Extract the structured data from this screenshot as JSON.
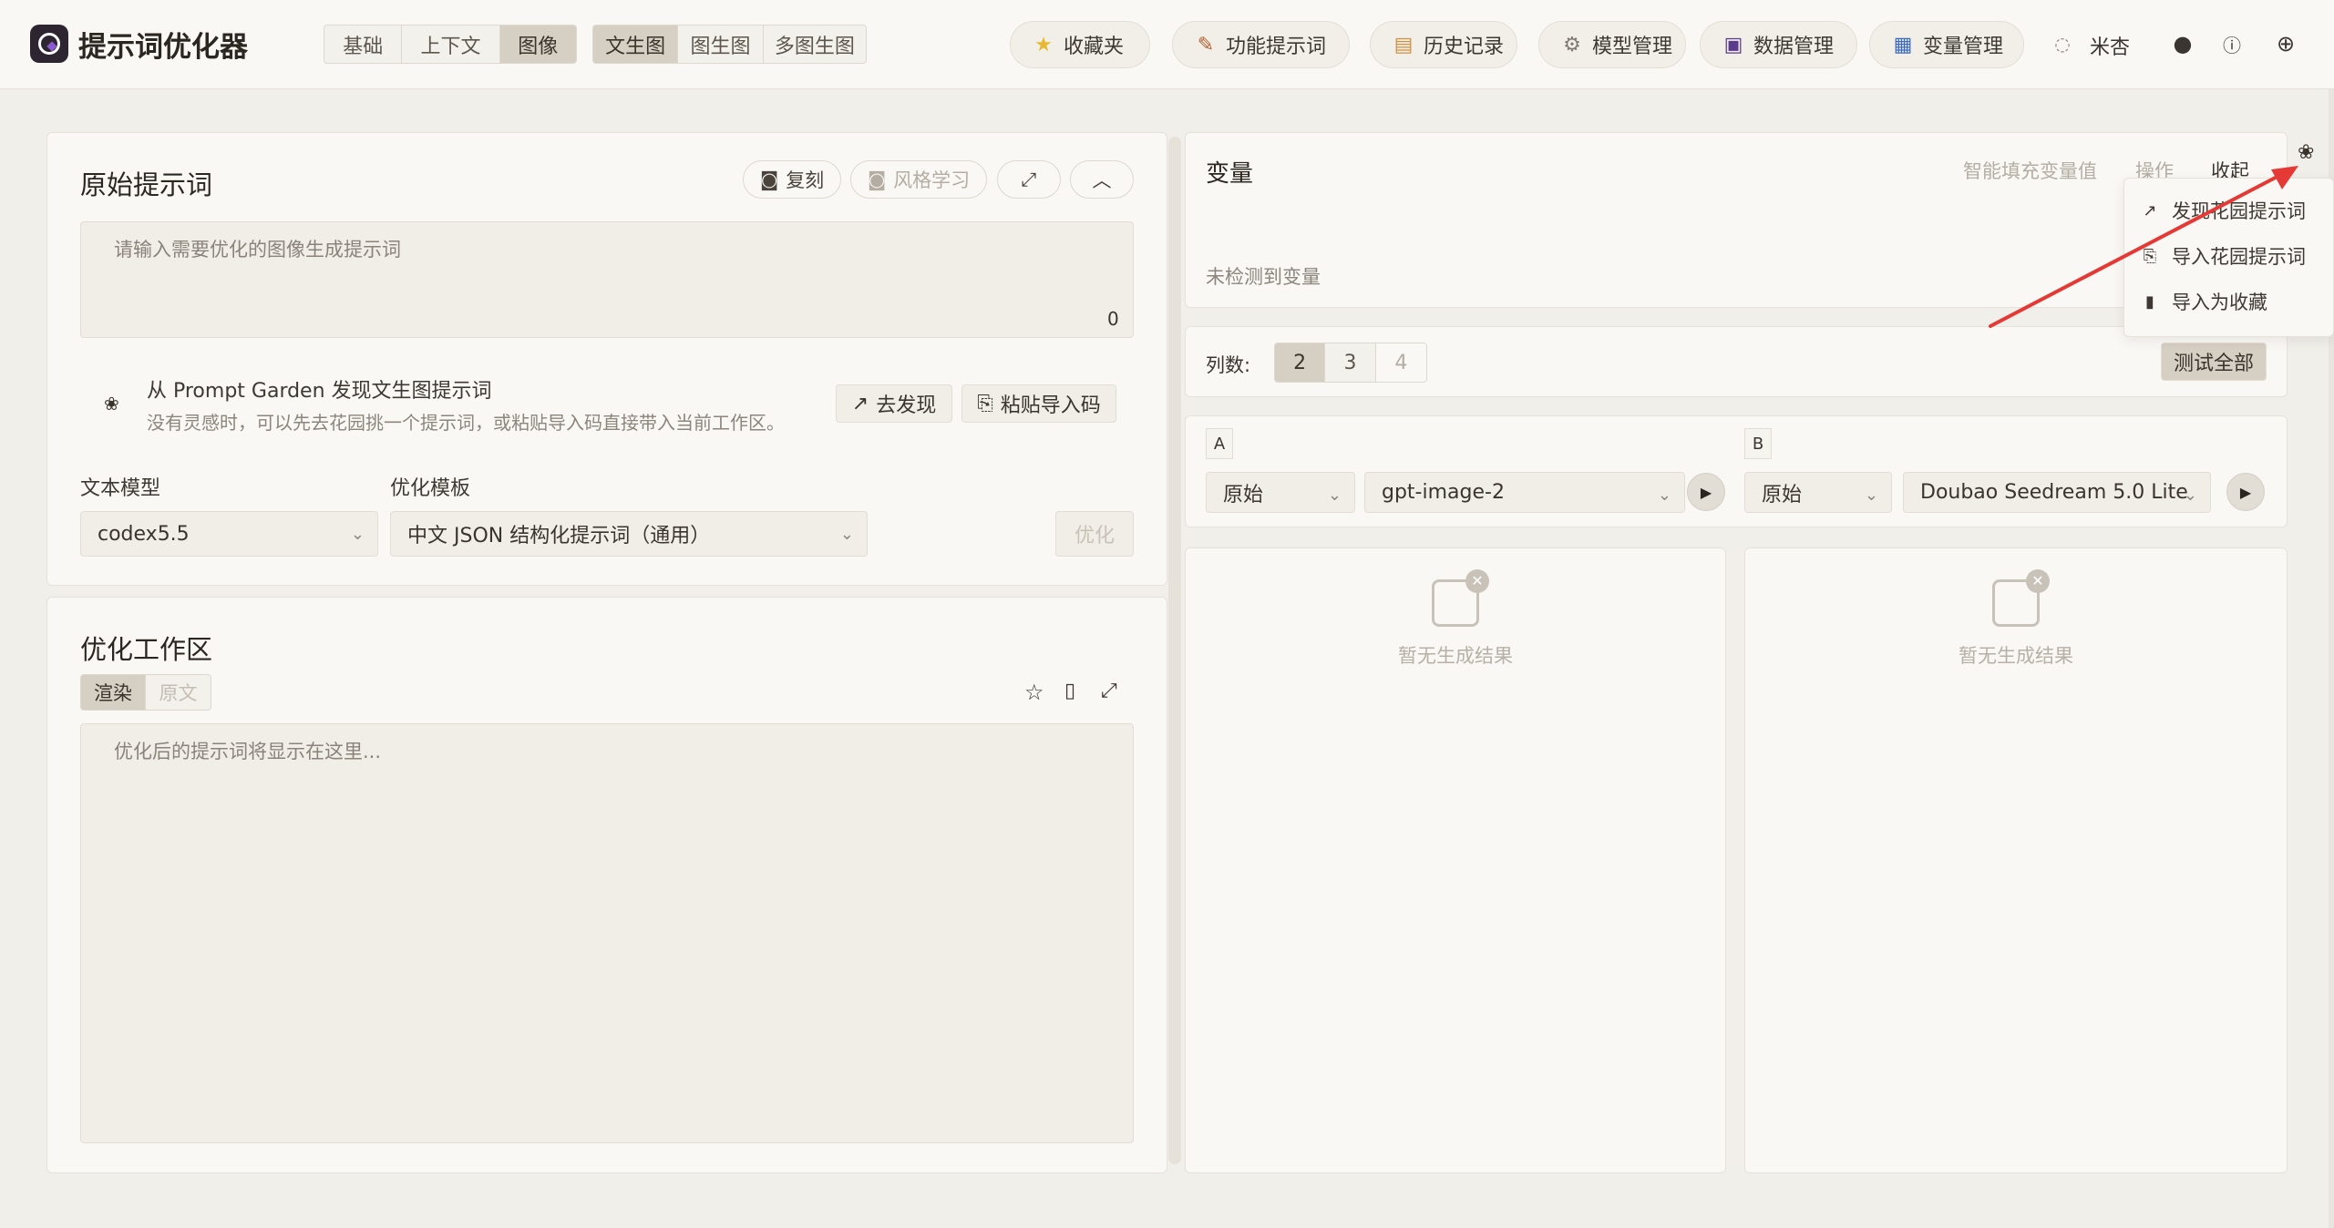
{
  "header": {
    "app_title": "提示词优化器",
    "mode_tabs": [
      "基础",
      "上下文",
      "图像"
    ],
    "active_mode": "图像",
    "image_tabs": [
      "文生图",
      "图生图",
      "多图生图"
    ],
    "active_image_tab": "文生图",
    "nav": {
      "favorites": "收藏夹",
      "function_prompts": "功能提示词",
      "history": "历史记录",
      "model_mgmt": "模型管理",
      "data_mgmt": "数据管理",
      "var_mgmt": "变量管理",
      "user": "米杏"
    }
  },
  "original": {
    "title": "原始提示词",
    "copy": "复刻",
    "style_learn": "风格学习",
    "placeholder": "请输入需要优化的图像生成提示词",
    "char_count": "0",
    "garden_title": "从 Prompt Garden 发现文生图提示词",
    "garden_desc": "没有灵感时，可以先去花园挑一个提示词，或粘贴导入码直接带入当前工作区。",
    "discover": "去发现",
    "paste_import": "粘贴导入码",
    "text_model_label": "文本模型",
    "text_model_value": "codex5.5",
    "template_label": "优化模板",
    "template_value": "中文 JSON 结构化提示词（通用）",
    "optimize": "优化"
  },
  "workspace": {
    "title": "优化工作区",
    "tab_render": "渲染",
    "tab_raw": "原文",
    "placeholder": "优化后的提示词将显示在这里..."
  },
  "variables": {
    "title": "变量",
    "smart_fill": "智能填充变量值",
    "actions": "操作",
    "collapse": "收起",
    "none_detected": "未检测到变量"
  },
  "columns": {
    "label": "列数:",
    "options": [
      "2",
      "3",
      "4"
    ],
    "selected": "2",
    "test_all": "测试全部"
  },
  "slots": {
    "a": {
      "tag": "A",
      "mode": "原始",
      "model": "gpt-image-2"
    },
    "b": {
      "tag": "B",
      "mode": "原始",
      "model": "Doubao Seedream 5.0 Lite"
    }
  },
  "results": {
    "empty_a": "暂无生成结果",
    "empty_b": "暂无生成结果"
  },
  "dropdown_menu": {
    "items": [
      "发现花园提示词",
      "导入花园提示词",
      "导入为收藏"
    ]
  },
  "colors": {
    "accent_red_arrow": "#e53935",
    "active_tab": "#d6cfc4",
    "background": "#f1efea",
    "panel": "#faf8f4"
  }
}
